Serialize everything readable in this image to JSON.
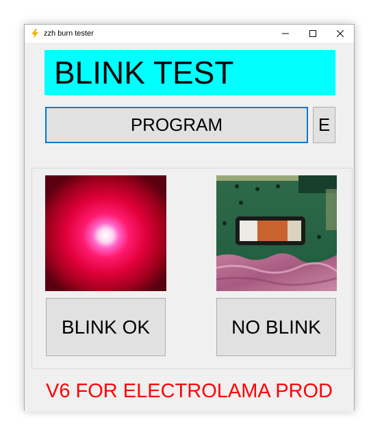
{
  "window": {
    "title": "zzh burn tester",
    "app_icon": "lightning-bolt-icon",
    "controls": [
      "minimize-icon",
      "maximize-icon",
      "close-icon"
    ]
  },
  "banner": {
    "text": "BLINK TEST",
    "color": "#00ffff"
  },
  "program_button": {
    "label": "PROGRAM"
  },
  "e_button": {
    "label": "E"
  },
  "images": {
    "left": "glowing red LED photo",
    "right": "circuit board SMD LED photo"
  },
  "blink_ok_button": {
    "label": "BLINK OK"
  },
  "no_blink_button": {
    "label": "NO BLINK"
  },
  "footer": {
    "text": "V6 FOR ELECTROLAMA PROD",
    "color": "#ff0000"
  }
}
